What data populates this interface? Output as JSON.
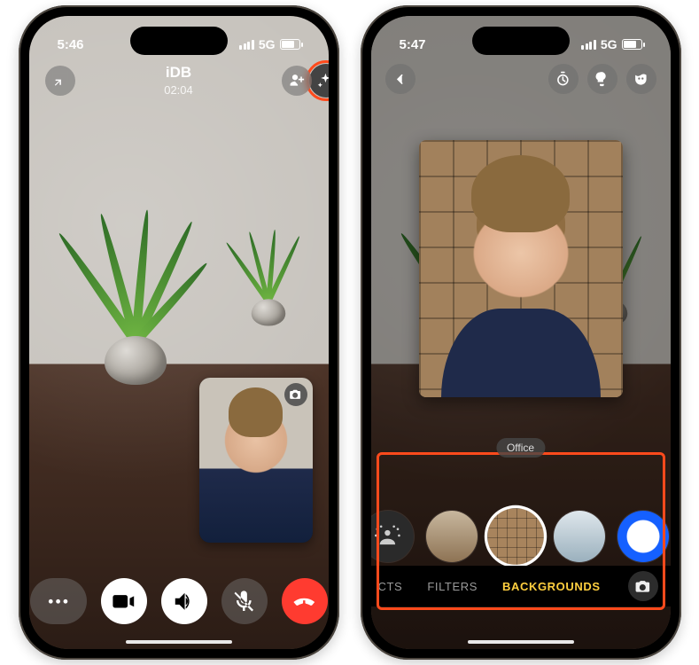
{
  "status": {
    "left_time": "5:46",
    "right_time": "5:47",
    "network": "5G"
  },
  "call": {
    "contact_name": "iDB",
    "duration": "02:04"
  },
  "backgrounds": {
    "selected_label": "Office",
    "tabs": {
      "effects_partial": "CTS",
      "filters": "FILTERS",
      "backgrounds": "BACKGROUNDS"
    }
  },
  "icons": {
    "minimize": "minimize-icon",
    "add_person": "add-person-icon",
    "back": "back-icon",
    "timer": "timer-icon",
    "flash": "flash-icon",
    "effects": "effects-icon",
    "flip_camera": "flip-camera-icon",
    "sparkle": "sparkle-icon",
    "more": "more-icon",
    "video": "video-icon",
    "speaker": "speaker-icon",
    "mute": "mute-icon",
    "end_call": "end-call-icon",
    "blur": "blur-icon",
    "camera": "camera-icon"
  }
}
